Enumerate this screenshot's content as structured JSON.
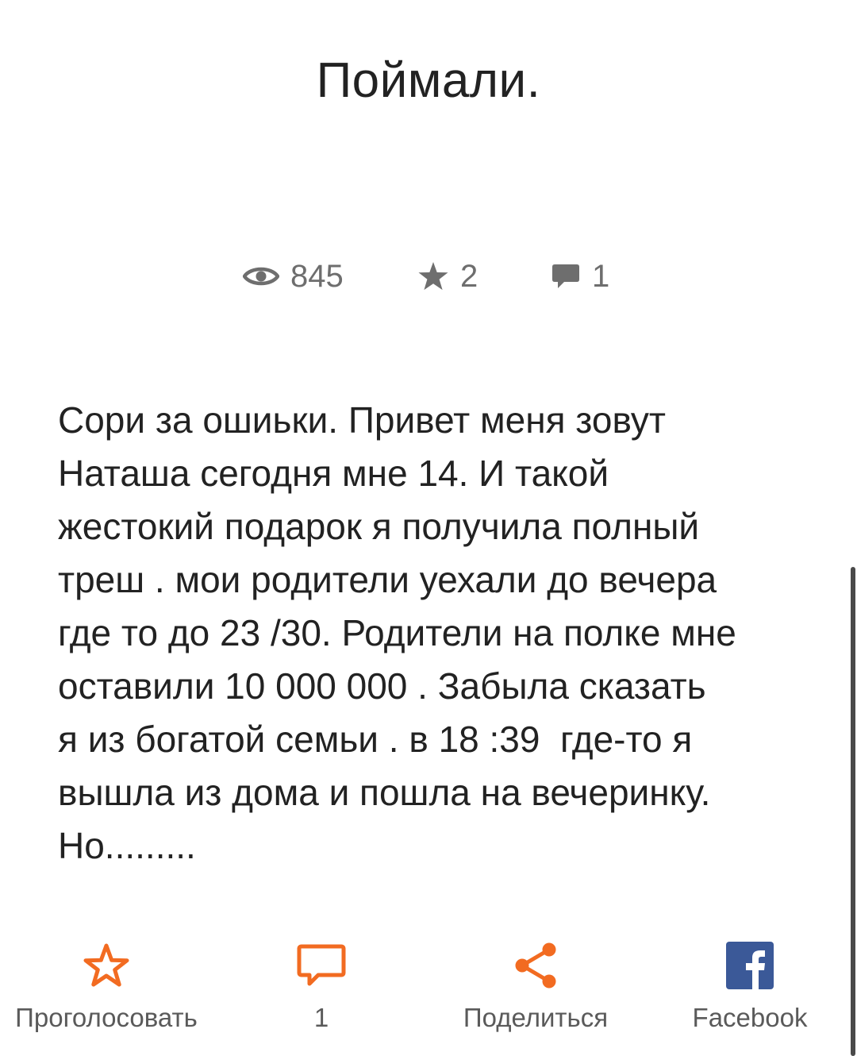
{
  "post": {
    "title": "Поймали.",
    "story": "Сори за ошиьки. Привет меня зовут\nНаташа сегодня мне 14. И такой\nжестокий подарок я получила полный\nтреш . мои родители уехали до вечера\nгде то до 23 /30. Родители на полке мне\nоставили 10 000 000 . Забыла сказать\nя из богатой семьи . в 18 :39  где-то я\nвышла из дома и пошла на вечеринку.\nНо........."
  },
  "stats": {
    "views": "845",
    "stars": "2",
    "comments": "1"
  },
  "actions": {
    "vote_label": "Проголосовать",
    "comments_count": "1",
    "share_label": "Поделиться",
    "facebook_label": "Facebook"
  },
  "icons": {
    "views": "eye-icon",
    "stars": "star-icon",
    "comments": "comment-icon",
    "vote": "star-outline-icon",
    "comment_action": "comment-outline-icon",
    "share": "share-icon",
    "facebook": "facebook-icon"
  },
  "colors": {
    "accent": "#f26b21",
    "facebook": "#3b5998",
    "stat_gray": "#6e6e6e",
    "text": "#222222"
  }
}
